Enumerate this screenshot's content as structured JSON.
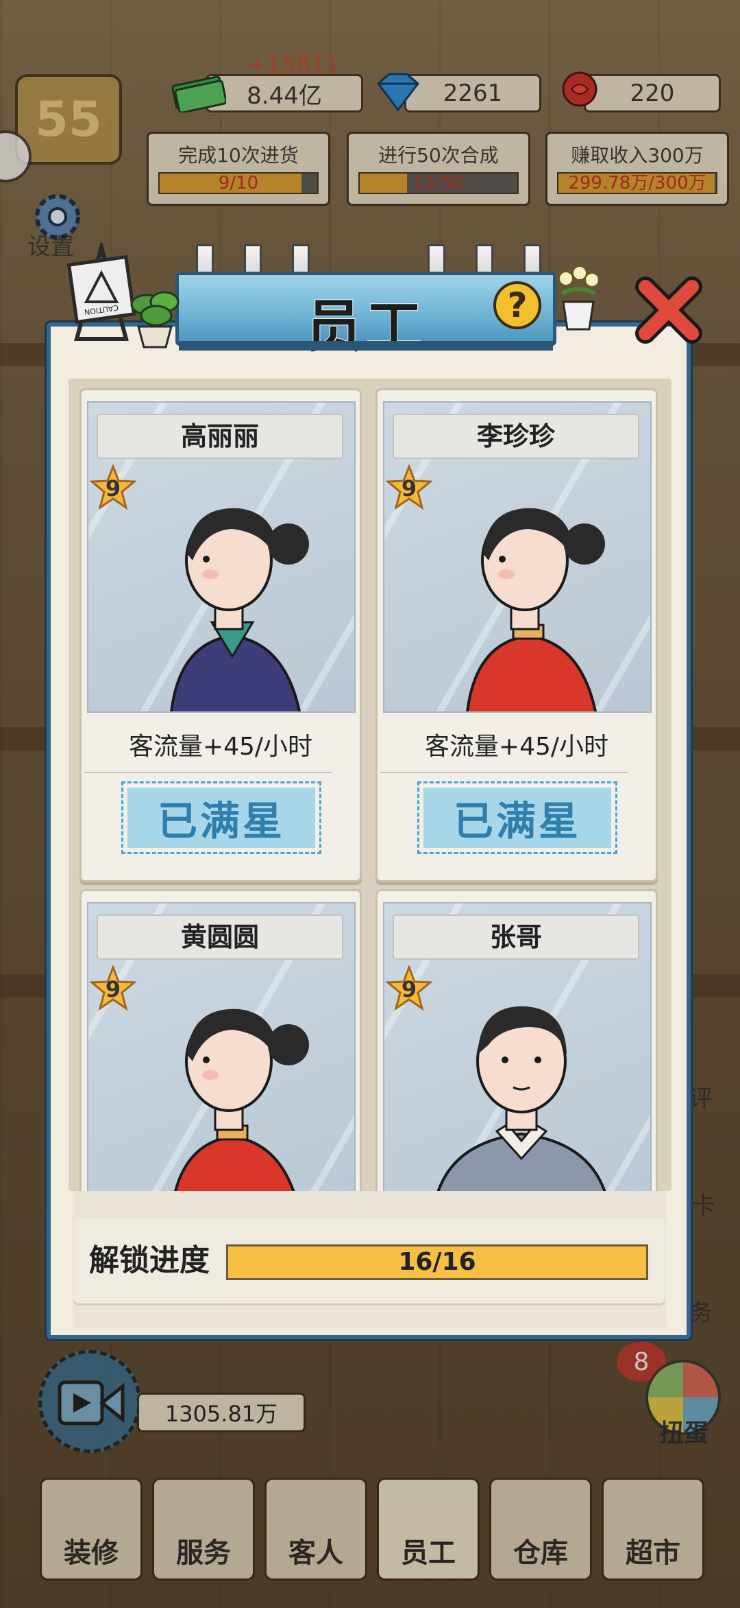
{
  "hud": {
    "income_delta": "+15811",
    "money": "8.44亿",
    "diamonds": "2261",
    "roses": "220",
    "level": "55",
    "settings_label": "设置"
  },
  "tasks": [
    {
      "title": "完成10次进货",
      "progress_text": "9/10",
      "progress": 0.9
    },
    {
      "title": "进行50次合成",
      "progress_text": "15/50",
      "progress": 0.3
    },
    {
      "title": "赚取收入300万",
      "progress_text": "299.78万/300万",
      "progress": 0.999
    }
  ],
  "side_hints": [
    "评",
    "卡",
    "务"
  ],
  "modal": {
    "title": "员工",
    "help_symbol": "?",
    "caution_text": "CAUTION"
  },
  "staff": [
    {
      "name": "高丽丽",
      "stars": "9",
      "stat": "客流量+45/小时",
      "button": "已满星",
      "outfit": "#3f3c7a",
      "accent": "#3a9a8a"
    },
    {
      "name": "李珍珍",
      "stars": "9",
      "stat": "客流量+45/小时",
      "button": "已满星",
      "outfit": "#d8372a",
      "accent": "#e8b15a"
    },
    {
      "name": "黄圆圆",
      "stars": "9",
      "stat": "",
      "button": "",
      "outfit": "#d8372a",
      "accent": "#e8b15a"
    },
    {
      "name": "张哥",
      "stars": "9",
      "stat": "",
      "button": "",
      "outfit": "#8b97aa",
      "accent": "#f1eee6"
    }
  ],
  "unlock": {
    "label": "解锁进度",
    "value": "16/16",
    "progress": 1.0
  },
  "bottom": {
    "video_money": "1305.81万",
    "gacha_label": "扭蛋",
    "gacha_badge": "8",
    "nav": [
      "装修",
      "服务",
      "客人",
      "员工",
      "仓库",
      "超市"
    ]
  }
}
